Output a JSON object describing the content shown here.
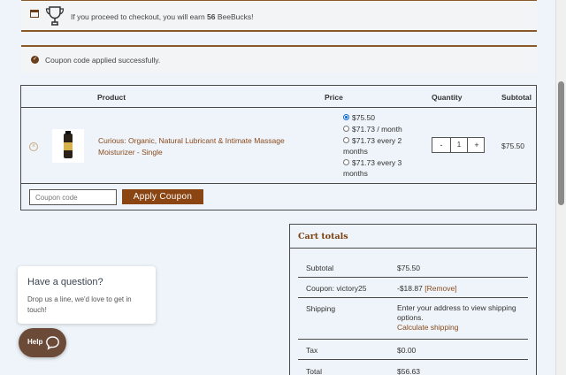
{
  "notices": {
    "points_prefix": "If you proceed to checkout, you will earn",
    "points_amount": "56",
    "points_suffix": "BeeBucks!",
    "coupon_applied": "Coupon code applied successfully."
  },
  "cart": {
    "headers": {
      "product": "Product",
      "price": "Price",
      "quantity": "Quantity",
      "subtotal": "Subtotal"
    },
    "item": {
      "name": "Curious: Organic, Natural Lubricant & Intimate Massage Moisturizer - Single",
      "price_options": [
        {
          "label": "$75.50",
          "selected": true
        },
        {
          "label": "$71.73 / month",
          "selected": false
        },
        {
          "label": "$71.73 every 2 months",
          "selected": false
        },
        {
          "label": "$71.73 every 3 months",
          "selected": false
        }
      ],
      "quantity": "1",
      "minus": "-",
      "plus": "+",
      "subtotal": "$75.50",
      "remove_icon": "×"
    },
    "coupon_placeholder": "Coupon code",
    "apply_coupon_label": "Apply Coupon"
  },
  "totals": {
    "title": "Cart totals",
    "rows": {
      "subtotal_label": "Subtotal",
      "subtotal_value": "$75.50",
      "coupon_label": "Coupon: victory25",
      "coupon_value": "-$18.87",
      "coupon_remove": "[Remove]",
      "shipping_label": "Shipping",
      "shipping_value": "Enter your address to view shipping options.",
      "shipping_link": "Calculate shipping",
      "tax_label": "Tax",
      "tax_value": "$0.00",
      "total_label": "Total",
      "total_value": "$56.63"
    }
  },
  "help": {
    "title": "Have a question?",
    "text": "Drop us a line, we'd love to get in touch!",
    "button_label": "Help"
  },
  "colors": {
    "accent": "#8a4513",
    "link": "#8a4a1e",
    "background": "#eef4f9"
  }
}
